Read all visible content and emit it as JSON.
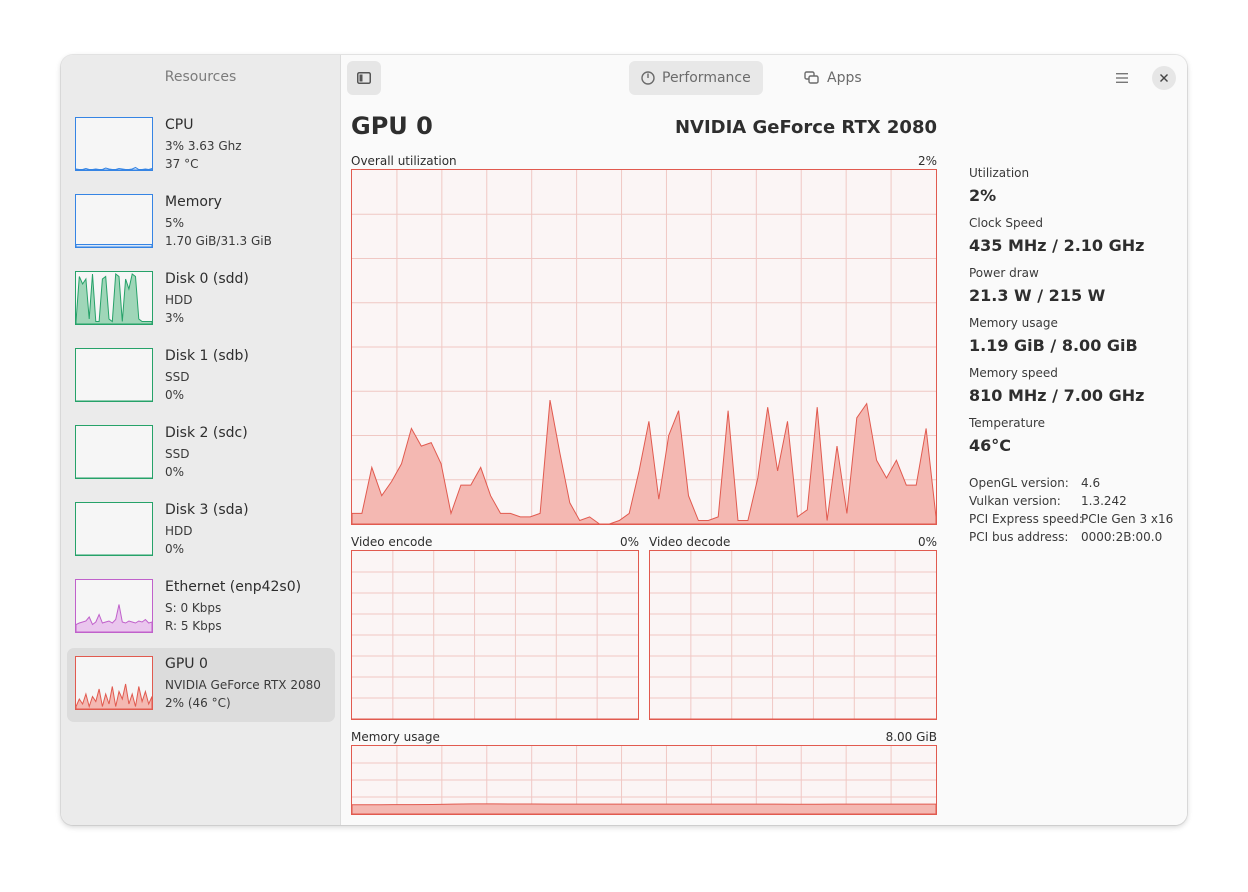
{
  "sidebar": {
    "title": "Resources",
    "items": [
      {
        "name": "CPU",
        "line1": "3% 3.63 Ghz",
        "line2": "37 °C",
        "color": "#3584e4",
        "fill": "#dbe8f8"
      },
      {
        "name": "Memory",
        "line1": "5%",
        "line2": "1.70 GiB/31.3 GiB",
        "color": "#3584e4",
        "fill": "#dbe8f8"
      },
      {
        "name": "Disk 0 (sdd)",
        "line1": "HDD",
        "line2": "3%",
        "color": "#26a269",
        "fill": "#9fd6b8"
      },
      {
        "name": "Disk 1 (sdb)",
        "line1": "SSD",
        "line2": "0%",
        "color": "#26a269",
        "fill": "#9fd6b8"
      },
      {
        "name": "Disk 2 (sdc)",
        "line1": "SSD",
        "line2": "0%",
        "color": "#26a269",
        "fill": "#9fd6b8"
      },
      {
        "name": "Disk 3 (sda)",
        "line1": "HDD",
        "line2": "0%",
        "color": "#26a269",
        "fill": "#9fd6b8"
      },
      {
        "name": "Ethernet (enp42s0)",
        "line1": "S: 0 Kbps",
        "line2": "R: 5 Kbps",
        "color": "#c061cb",
        "fill": "#eac6ee"
      },
      {
        "name": "GPU 0",
        "line1": "NVIDIA GeForce RTX 2080",
        "line2": "2% (46 °C)",
        "color": "#e15a4f",
        "fill": "#f4b8b2"
      }
    ]
  },
  "header": {
    "tab_performance": "Performance",
    "tab_apps": "Apps"
  },
  "main": {
    "title": "GPU 0",
    "model": "NVIDIA GeForce RTX 2080",
    "graphs": {
      "overall": {
        "label": "Overall utilization",
        "value": "2%"
      },
      "encode": {
        "label": "Video encode",
        "value": "0%"
      },
      "decode": {
        "label": "Video decode",
        "value": "0%"
      },
      "memory": {
        "label": "Memory usage",
        "value": "8.00 GiB"
      }
    },
    "stats": [
      {
        "label": "Utilization",
        "value": "2%"
      },
      {
        "label": "Clock Speed",
        "value": "435 MHz / 2.10 GHz"
      },
      {
        "label": "Power draw",
        "value": "21.3 W / 215 W"
      },
      {
        "label": "Memory usage",
        "value": "1.19 GiB / 8.00 GiB"
      },
      {
        "label": "Memory speed",
        "value": "810 MHz / 7.00 GHz"
      },
      {
        "label": "Temperature",
        "value": "46°C"
      }
    ],
    "info": [
      {
        "key": "OpenGL version:",
        "value": "4.6"
      },
      {
        "key": "Vulkan version:",
        "value": "1.3.242"
      },
      {
        "key": "PCI Express speed:",
        "value": "PCIe Gen 3 x16"
      },
      {
        "key": "PCI bus address:",
        "value": "0000:2B:00.0"
      }
    ]
  },
  "chart_data": [
    {
      "type": "area",
      "title": "Overall utilization",
      "ylim": [
        0,
        100
      ],
      "series": [
        {
          "values": [
            3,
            3,
            16,
            8,
            12,
            17,
            27,
            22,
            23,
            17,
            3,
            11,
            11,
            16,
            8,
            3,
            3,
            2,
            2,
            3,
            35,
            20,
            6,
            1,
            2,
            0,
            0,
            1,
            3,
            15,
            29,
            7,
            25,
            32,
            8,
            1,
            1,
            2,
            32,
            1,
            1,
            13,
            33,
            15,
            29,
            2,
            4,
            33,
            1,
            22,
            3,
            30,
            34,
            18,
            13,
            18,
            11,
            11,
            27,
            2
          ]
        }
      ],
      "color": "#e15a4f"
    },
    {
      "type": "area",
      "title": "Video encode",
      "ylim": [
        0,
        100
      ],
      "series": [
        {
          "values": [
            0,
            0,
            0,
            0,
            0,
            0,
            0,
            0,
            0,
            0
          ]
        }
      ],
      "color": "#e15a4f"
    },
    {
      "type": "area",
      "title": "Video decode",
      "ylim": [
        0,
        100
      ],
      "series": [
        {
          "values": [
            0,
            0,
            0,
            0,
            0,
            0,
            0,
            0,
            0,
            0
          ]
        }
      ],
      "color": "#e15a4f"
    },
    {
      "type": "area",
      "title": "Memory usage",
      "ylim": [
        0,
        8
      ],
      "series": [
        {
          "values": [
            1.08,
            1.08,
            1.1,
            1.1,
            1.12,
            1.16,
            1.19,
            1.19,
            1.18,
            1.18,
            1.17,
            1.17,
            1.17,
            1.17,
            1.17,
            1.16,
            1.16,
            1.16,
            1.16,
            1.16,
            1.16,
            1.16,
            1.15,
            1.15,
            1.16,
            1.16,
            1.16,
            1.16,
            1.16,
            1.16
          ]
        }
      ],
      "color": "#e15a4f"
    }
  ]
}
